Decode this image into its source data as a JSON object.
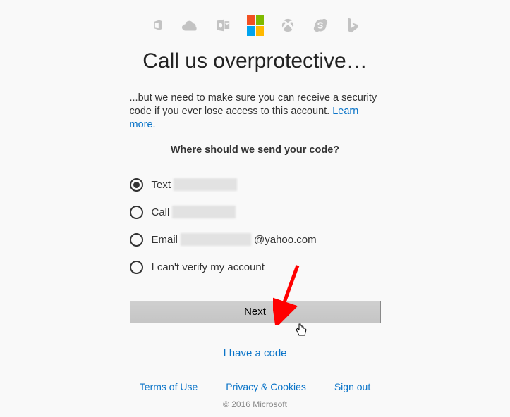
{
  "header_icons": {
    "office": "office-icon",
    "onedrive": "onedrive-icon",
    "outlook": "outlook-icon",
    "microsoft": "microsoft-logo",
    "xbox": "xbox-icon",
    "skype": "skype-icon",
    "bing": "bing-icon"
  },
  "title": "Call us overprotective…",
  "description_prefix": "...but we need to make sure you can receive a security code if you ever lose access to this account. ",
  "learn_more_label": "Learn more.",
  "prompt": "Where should we send your code?",
  "options": [
    {
      "id": "text",
      "label_prefix": "Text ",
      "masked": true,
      "label_suffix": "",
      "selected": true
    },
    {
      "id": "call",
      "label_prefix": "Call ",
      "masked": true,
      "label_suffix": "",
      "selected": false
    },
    {
      "id": "email",
      "label_prefix": "Email",
      "masked": true,
      "label_suffix": "@yahoo.com",
      "selected": false
    },
    {
      "id": "cant",
      "label_prefix": "I can't verify my account",
      "masked": false,
      "label_suffix": "",
      "selected": false
    }
  ],
  "next_button": "Next",
  "have_code": "I have a code",
  "footer": {
    "terms": "Terms of Use",
    "privacy": "Privacy & Cookies",
    "signout": "Sign out"
  },
  "copyright": "© 2016 Microsoft",
  "annotation": {
    "arrow_color": "#ff0000"
  }
}
